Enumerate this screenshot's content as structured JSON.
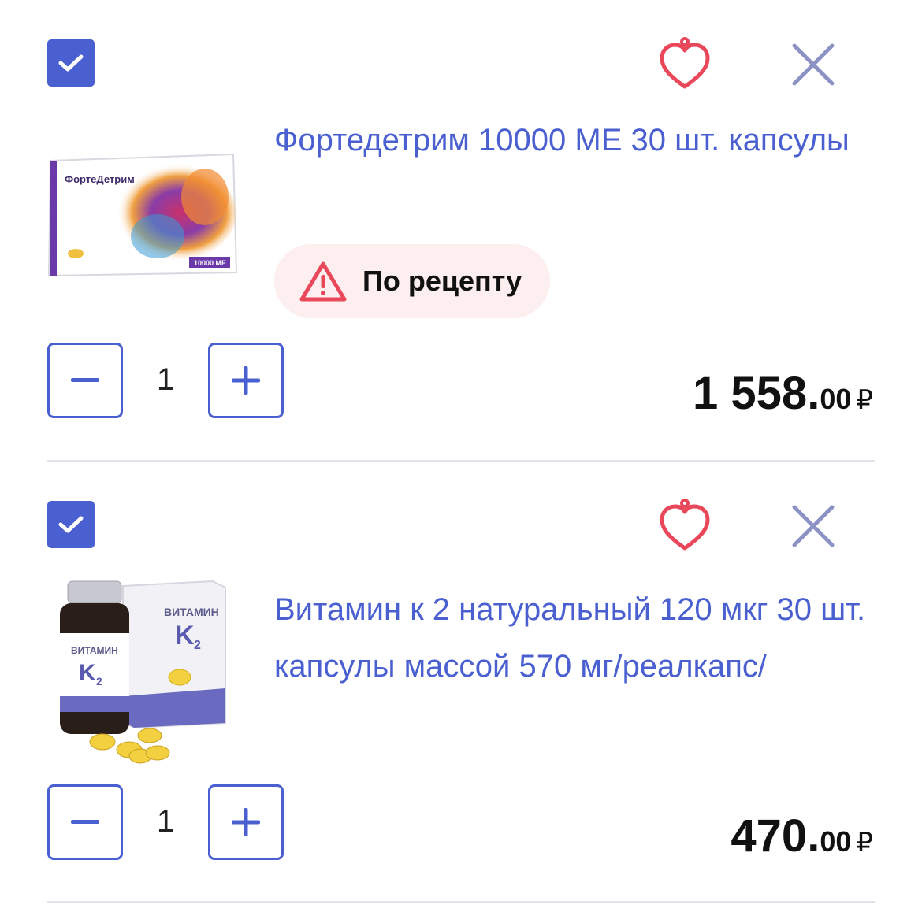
{
  "colors": {
    "accent": "#4a5fd0",
    "favorite": "#e8485a",
    "remove": "#8c92c4",
    "rx_bg": "#fdeef0",
    "warning": "#e8485a"
  },
  "cart": {
    "items": [
      {
        "checked": true,
        "title": "Фортедетрим 10000 МЕ 30 шт. капсулы",
        "rx_badge": "По рецепту",
        "quantity": "1",
        "price_main": "1 558.",
        "price_cents": "00",
        "currency": "₽",
        "thumb_brand": "ФортеДетрим",
        "thumb_dose": "10000 МЕ"
      },
      {
        "checked": true,
        "title": "Витамин к 2 натуральный 120 мкг 30 шт. капсулы массой 570 мг/реалкапс/",
        "quantity": "1",
        "price_main": "470.",
        "price_cents": "00",
        "currency": "₽",
        "thumb_brand": "ВИТАМИН",
        "thumb_k": "K",
        "thumb_sub": "2"
      }
    ]
  },
  "icons": {
    "checkbox": "check-icon",
    "favorite": "heart-icon",
    "remove": "close-icon",
    "rx": "warning-triangle-icon",
    "minus": "minus-icon",
    "plus": "plus-icon"
  }
}
